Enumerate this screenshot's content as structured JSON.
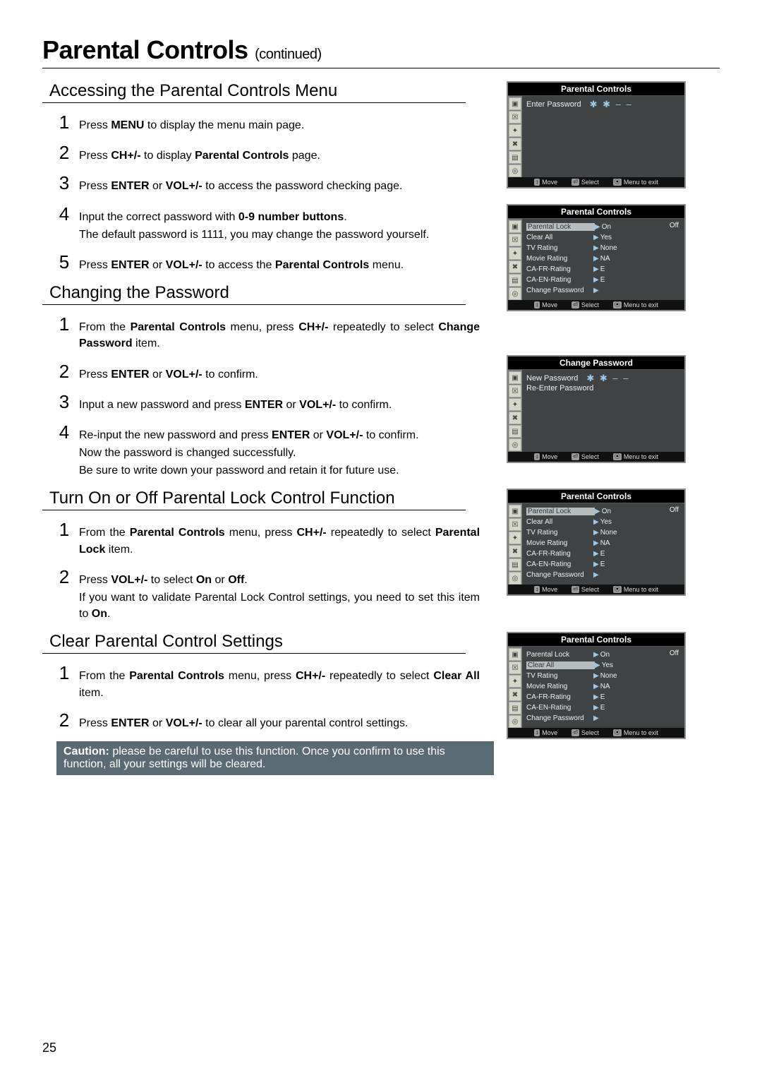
{
  "page": {
    "title": "Parental Controls",
    "title_suffix": "(continued)",
    "page_number": "25"
  },
  "sections": {
    "accessing": {
      "heading": "Accessing the Parental Controls Menu",
      "steps": [
        "Press <b>MENU</b> to display the menu main page.",
        "Press <b>CH+/-</b> to display <b>Parental Controls</b> page.",
        "Press <b>ENTER</b> or <b>VOL+/-</b> to access the password checking page.",
        "Input the correct password with <b>0-9 number buttons</b>.<span class='note'>The default password is 1111, you may change the password yourself.</span>",
        "Press <b>ENTER</b> or <b>VOL+/-</b> to access the <b>Parental Controls</b> menu."
      ]
    },
    "changing": {
      "heading": "Changing the Password",
      "steps": [
        "From the <b>Parental Controls</b> menu, press <b>CH+/-</b> repeatedly to select <b>Change Password</b> item.",
        "Press <b>ENTER</b> or <b>VOL+/-</b> to confirm.",
        "Input a new password and press <b>ENTER</b> or <b>VOL+/-</b> to confirm.",
        "Re-input the new password and press <b>ENTER</b> or <b>VOL+/-</b> to confirm.<span class='note'>Now the password is changed successfully.</span><span class='note'>Be sure to write down your password and retain it for future use.</span>"
      ]
    },
    "lock": {
      "heading": "Turn On or Off Parental Lock Control Function",
      "steps": [
        "From the <b>Parental Controls</b> menu, press <b>CH+/-</b> repeatedly to select <b>Parental Lock</b> item.",
        "Press <b>VOL+/-</b> to select <b>On</b> or <b>Off</b>.<span class='note'>If you want to validate Parental Lock Control settings, you need to set this item to <b>On</b>.</span>"
      ]
    },
    "clear": {
      "heading": "Clear Parental Control Settings",
      "steps": [
        "From the <b>Parental Controls</b> menu, press <b>CH+/-</b> repeatedly to select <b>Clear All</b> item.",
        "Press <b>ENTER</b> or <b>VOL+/-</b> to clear all your parental control settings."
      ],
      "caution": "<b>Caution:</b> please be careful to use this function. Once you confirm to use this function, all your settings will be cleared."
    }
  },
  "osd": {
    "footer": {
      "move": "Move",
      "select": "Select",
      "exit": "Menu to exit"
    },
    "icons": [
      "▣",
      "☒",
      "✦",
      "✖",
      "▤",
      "◎"
    ],
    "screens": {
      "enter_pw": {
        "title": "Parental Controls",
        "rows": [
          {
            "label": "Enter Password",
            "value": "✱ ✱ – –"
          }
        ]
      },
      "menu1": {
        "title": "Parental Controls",
        "off": "Off",
        "rows": [
          {
            "label": "Parental Lock",
            "value": "On",
            "selected": true
          },
          {
            "label": "Clear All",
            "value": "Yes"
          },
          {
            "label": "TV Rating",
            "value": "None"
          },
          {
            "label": "Movie Rating",
            "value": "NA"
          },
          {
            "label": "CA-FR-Rating",
            "value": "E"
          },
          {
            "label": "CA-EN-Rating",
            "value": "E"
          },
          {
            "label": "Change Password",
            "value": ""
          }
        ]
      },
      "change_pw": {
        "title": "Change Password",
        "rows": [
          {
            "label": "New Password",
            "value": "✱ ✱ – –"
          },
          {
            "label": "Re-Enter Password",
            "value": ""
          }
        ]
      },
      "menu2": {
        "title": "Parental Controls",
        "off": "Off",
        "rows": [
          {
            "label": "Parental Lock",
            "value": "On",
            "selected": true
          },
          {
            "label": "Clear All",
            "value": "Yes"
          },
          {
            "label": "TV Rating",
            "value": "None"
          },
          {
            "label": "Movie Rating",
            "value": "NA"
          },
          {
            "label": "CA-FR-Rating",
            "value": "E"
          },
          {
            "label": "CA-EN-Rating",
            "value": "E"
          },
          {
            "label": "Change Password",
            "value": ""
          }
        ]
      },
      "menu3": {
        "title": "Parental Controls",
        "off": "Off",
        "rows": [
          {
            "label": "Parental Lock",
            "value": "On"
          },
          {
            "label": "Clear All",
            "value": "Yes",
            "selected": true
          },
          {
            "label": "TV Rating",
            "value": "None"
          },
          {
            "label": "Movie Rating",
            "value": "NA"
          },
          {
            "label": "CA-FR-Rating",
            "value": "E"
          },
          {
            "label": "CA-EN-Rating",
            "value": "E"
          },
          {
            "label": "Change Password",
            "value": ""
          }
        ]
      }
    }
  }
}
